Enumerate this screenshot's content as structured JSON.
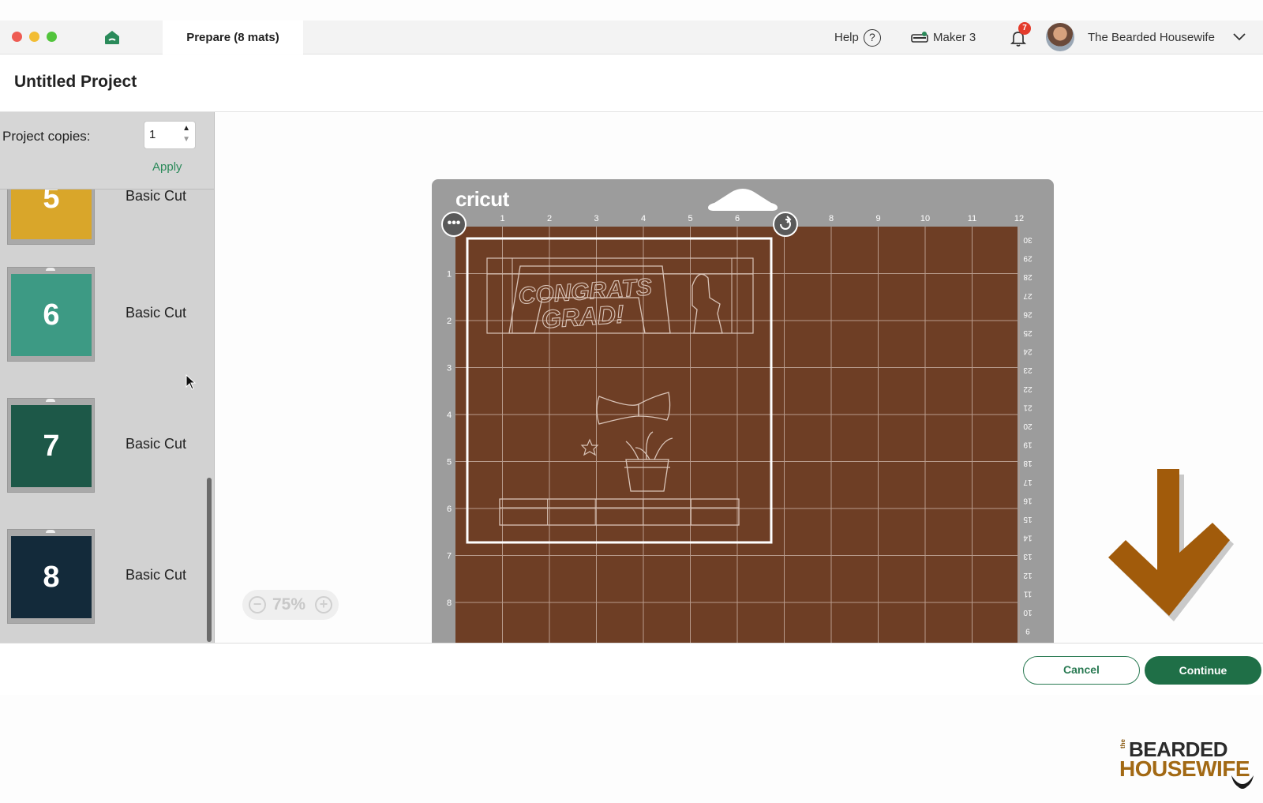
{
  "window": {
    "tab_title": "Prepare (8 mats)",
    "help_label": "Help",
    "help_icon": "?",
    "machine_label": "Maker 3",
    "notification_count": "7",
    "user_name": "The Bearded Housewife"
  },
  "project": {
    "title": "Untitled Project"
  },
  "sidebar": {
    "copies_label": "Project copies:",
    "copies_value": "1",
    "apply_label": "Apply",
    "mats": [
      {
        "number": "5",
        "label": "Basic Cut",
        "color": "#d9a62a"
      },
      {
        "number": "6",
        "label": "Basic Cut",
        "color": "#3d9a84"
      },
      {
        "number": "7",
        "label": "Basic Cut",
        "color": "#1d5848"
      },
      {
        "number": "8",
        "label": "Basic Cut",
        "color": "#132a3a"
      }
    ]
  },
  "mat_preview": {
    "brand": "cricut",
    "mat_color": "#6e3e25",
    "top_ruler": [
      "1",
      "2",
      "3",
      "4",
      "5",
      "6",
      "7",
      "8",
      "9",
      "10",
      "11",
      "12"
    ],
    "left_ruler": [
      "1",
      "2",
      "3",
      "4",
      "5",
      "6",
      "7",
      "8"
    ],
    "right_ruler": [
      "30",
      "29",
      "28",
      "27",
      "26",
      "25",
      "24",
      "23",
      "22",
      "21",
      "20",
      "19",
      "18",
      "17",
      "16",
      "15",
      "14",
      "13",
      "12",
      "11",
      "10",
      "9"
    ],
    "design_text_line1": "CONGRATS",
    "design_text_line2": "GRAD!",
    "zoom_value": "75%",
    "zoom_minus": "−",
    "zoom_plus": "+"
  },
  "footer": {
    "cancel_label": "Cancel",
    "continue_label": "Continue"
  },
  "watermark": {
    "the": "the",
    "line1": "BEARDED",
    "line2": "HOUSEWIFE"
  },
  "colors": {
    "accent_green": "#1f6f47",
    "arrow_brown": "#a15b0b"
  }
}
